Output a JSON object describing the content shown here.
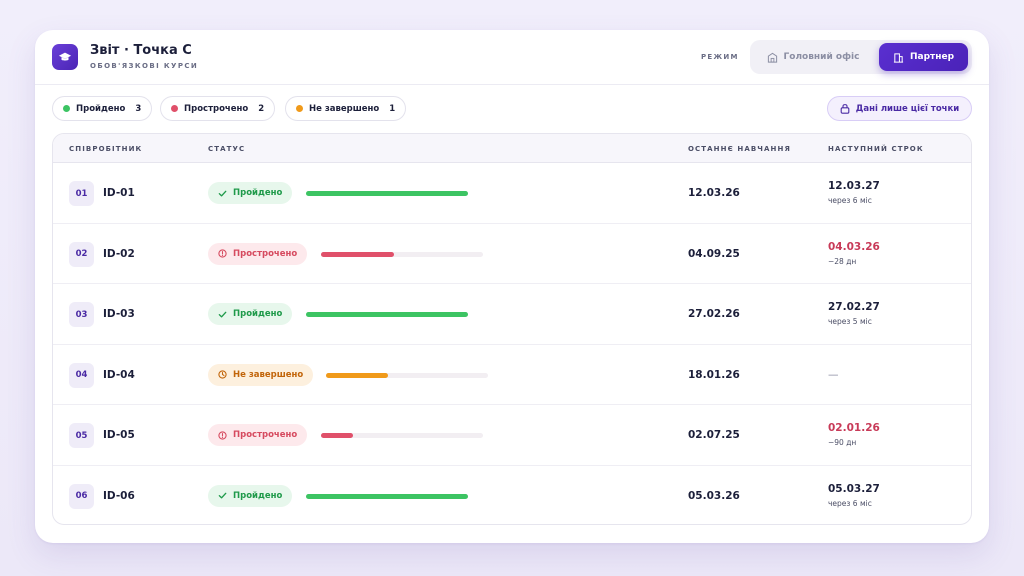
{
  "header": {
    "title": "Звіт · Точка C",
    "subtitle": "ОБОВ'ЯЗКОВІ КУРСИ",
    "mode_label": "РЕЖИМ",
    "modes": [
      {
        "label": "Головний офіс",
        "icon": "building-icon",
        "active": false
      },
      {
        "label": "Партнер",
        "icon": "storefront-icon",
        "active": true
      }
    ]
  },
  "filters": [
    {
      "label": "Пройдено",
      "count": "3",
      "color": "#3cc463"
    },
    {
      "label": "Прострочено",
      "count": "2",
      "color": "#e0506a"
    },
    {
      "label": "Не завершено",
      "count": "1",
      "color": "#f09a1a"
    }
  ],
  "scope_button": {
    "label": "Дані лише цієї точки",
    "icon": "lock-icon"
  },
  "table": {
    "columns": [
      "СПІВРОБІТНИК",
      "СТАТУС",
      "ОСТАННЄ НАВЧАННЯ",
      "НАСТУПНИЙ СТРОК"
    ],
    "rows": [
      {
        "num": "01",
        "id": "ID-01",
        "status": "Пройдено",
        "kind": "ok",
        "progress": 1.0,
        "last": "12.03.26",
        "due": "12.03.27",
        "due_note": "через 6 міс",
        "due_style": "normal"
      },
      {
        "num": "02",
        "id": "ID-02",
        "status": "Прострочено",
        "kind": "late",
        "progress": 0.45,
        "last": "04.09.25",
        "due": "04.03.26",
        "due_note": "−28 дн",
        "due_style": "red"
      },
      {
        "num": "03",
        "id": "ID-03",
        "status": "Пройдено",
        "kind": "ok",
        "progress": 1.0,
        "last": "27.02.26",
        "due": "27.02.27",
        "due_note": "через 5 міс",
        "due_style": "normal"
      },
      {
        "num": "04",
        "id": "ID-04",
        "status": "Не завершено",
        "kind": "incomplete",
        "progress": 0.38,
        "last": "18.01.26",
        "due": "—",
        "due_note": "",
        "due_style": "dash"
      },
      {
        "num": "05",
        "id": "ID-05",
        "status": "Прострочено",
        "kind": "late",
        "progress": 0.2,
        "last": "02.07.25",
        "due": "02.01.26",
        "due_note": "−90 дн",
        "due_style": "red"
      },
      {
        "num": "06",
        "id": "ID-06",
        "status": "Пройдено",
        "kind": "ok",
        "progress": 1.0,
        "last": "05.03.26",
        "due": "05.03.27",
        "due_note": "через 6 міс",
        "due_style": "normal"
      }
    ]
  },
  "colors": {
    "accent": "#5a2fd0",
    "ok": "#3cc463",
    "late": "#e0506a",
    "incomplete": "#f09a1a"
  }
}
